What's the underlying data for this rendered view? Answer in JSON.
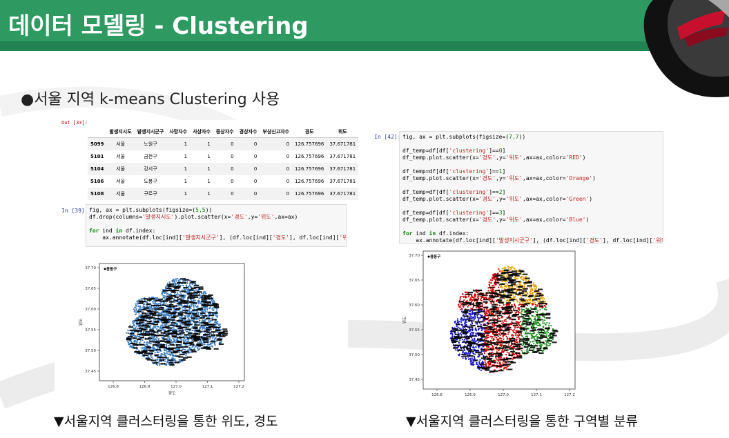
{
  "header": {
    "title": "데이터 모델링 - Clustering"
  },
  "subtitle": "●서울 지역 k-means Clustering 사용",
  "left": {
    "out_label": "Out [33]:",
    "table": {
      "columns": [
        "",
        "발생지시도",
        "발생지시군구",
        "사망자수",
        "사상자수",
        "중상자수",
        "경상자수",
        "부상신고자수",
        "경도",
        "위도"
      ],
      "rows": [
        [
          "5099",
          "서울",
          "노원구",
          "1",
          "1",
          "0",
          "0",
          "0",
          "126.757696",
          "37.671781"
        ],
        [
          "5101",
          "서울",
          "금천구",
          "1",
          "1",
          "0",
          "0",
          "0",
          "126.757696",
          "37.671781"
        ],
        [
          "5104",
          "서울",
          "강서구",
          "1",
          "1",
          "0",
          "0",
          "0",
          "126.757696",
          "37.671781"
        ],
        [
          "5106",
          "서울",
          "도봉구",
          "1",
          "1",
          "0",
          "0",
          "0",
          "126.757696",
          "37.671781"
        ],
        [
          "5108",
          "서울",
          "구로구",
          "1",
          "1",
          "0",
          "0",
          "0",
          "126.757696",
          "37.671781"
        ]
      ]
    },
    "in_label": "In [39]:",
    "code": [
      "fig, ax = plt.subplots(figsize=(5,5))",
      "df.drop(columns='발생지시도').plot.scatter(x='경도',y='위도',ax=ax)",
      "",
      "for ind in df.index:",
      "    ax.annotate(df.loc[ind]['발생지시군구'], (df.loc[ind]['경도'], df.loc[ind]['위도']))"
    ],
    "plot": {
      "yticks": [
        "37.70",
        "37.65",
        "37.60",
        "37.55",
        "37.50",
        "37.45"
      ],
      "xticks": [
        "126.8",
        "126.9",
        "127.0",
        "127.1",
        "127.2"
      ],
      "xlabel": "경도",
      "ylabel": "위도",
      "label": "용동구"
    }
  },
  "right": {
    "in_label": "In [42]:",
    "code": [
      "fig, ax = plt.subplots(figsize=(7,7))",
      "",
      "df_temp=df[df['clustering']==0]",
      "df_temp.plot.scatter(x='경도',y='위도',ax=ax,color='RED')",
      "",
      "df_temp=df[df['clustering']==1]",
      "df_temp.plot.scatter(x='경도',y='위도',ax=ax,color='Orange')",
      "",
      "df_temp=df[df['clustering']==2]",
      "df_temp.plot.scatter(x='경도',y='위도',ax=ax,color='Green')",
      "",
      "df_temp=df[df['clustering']==3]",
      "df_temp.plot.scatter(x='경도',y='위도',ax=ax,color='Blue')",
      "",
      "for ind in df.index:",
      "    ax.annotate(df.loc[ind]['발생지시군구'], (df.loc[ind]['경도'], df.loc[ind]['위도']))"
    ],
    "plot": {
      "yticks": [
        "37.70",
        "37.65",
        "37.60",
        "37.55",
        "37.50",
        "37.45"
      ],
      "xticks": [
        "126.8",
        "126.9",
        "127.0",
        "127.1",
        "127.2"
      ],
      "ylabel": "위도",
      "label": "용동구"
    }
  },
  "captions": {
    "left": "▼서울지역 클러스터링을 통한 위도, 경도",
    "right": "▼서울지역 클러스터링을 통한 구역별 분류"
  },
  "colors": {
    "header": "#2e9a62",
    "header_dark": "#218253",
    "cluster_red": "#d40000",
    "cluster_orange": "#e8a000",
    "cluster_green": "#1a8a1a",
    "cluster_blue": "#1a1acc",
    "point_default": "#3a7bbf"
  }
}
